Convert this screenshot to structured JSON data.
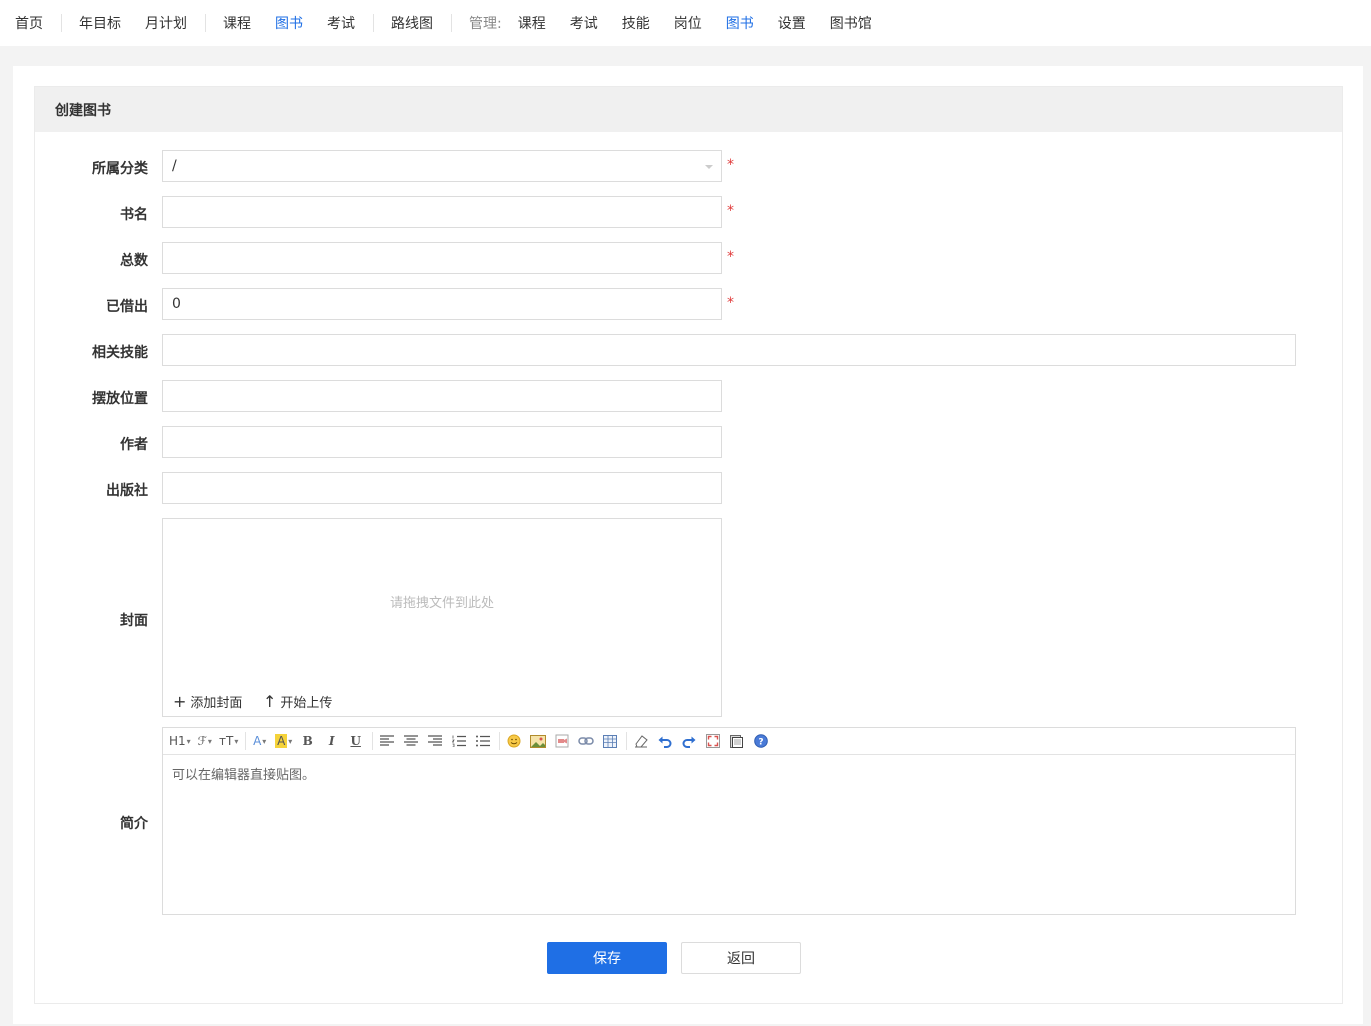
{
  "nav": {
    "items": [
      {
        "label": "首页",
        "active": false
      },
      {
        "label": "年目标",
        "active": false
      },
      {
        "label": "月计划",
        "active": false
      },
      {
        "label": "课程",
        "active": false
      },
      {
        "label": "图书",
        "active": true
      },
      {
        "label": "考试",
        "active": false
      },
      {
        "label": "路线图",
        "active": false
      }
    ],
    "mgmt_label": "管理:",
    "mgmt_items": [
      {
        "label": "课程",
        "active": false
      },
      {
        "label": "考试",
        "active": false
      },
      {
        "label": "技能",
        "active": false
      },
      {
        "label": "岗位",
        "active": false
      },
      {
        "label": "图书",
        "active": true
      },
      {
        "label": "设置",
        "active": false
      },
      {
        "label": "图书馆",
        "active": false
      }
    ]
  },
  "form": {
    "title": "创建图书",
    "category": {
      "label": "所属分类",
      "value": "/"
    },
    "name": {
      "label": "书名",
      "value": ""
    },
    "total": {
      "label": "总数",
      "value": ""
    },
    "borrowed": {
      "label": "已借出",
      "value": "0"
    },
    "skills": {
      "label": "相关技能",
      "value": ""
    },
    "location": {
      "label": "摆放位置",
      "value": ""
    },
    "author": {
      "label": "作者",
      "value": ""
    },
    "publisher": {
      "label": "出版社",
      "value": ""
    },
    "cover": {
      "label": "封面",
      "drop_hint": "请拖拽文件到此处",
      "add_label": "添加封面",
      "upload_label": "开始上传"
    },
    "intro": {
      "label": "简介",
      "placeholder": "可以在编辑器直接贴图。"
    },
    "required_mark": "*",
    "save_label": "保存",
    "back_label": "返回"
  },
  "toolbar": {
    "heading": "H1",
    "font_family": "ℱ",
    "font_size": "тT",
    "font_color": "A",
    "bg_color": "A",
    "bold": "B",
    "italic": "I",
    "underline": "U"
  },
  "colors": {
    "accent": "#1f6fe5",
    "required": "#e03a3a"
  }
}
